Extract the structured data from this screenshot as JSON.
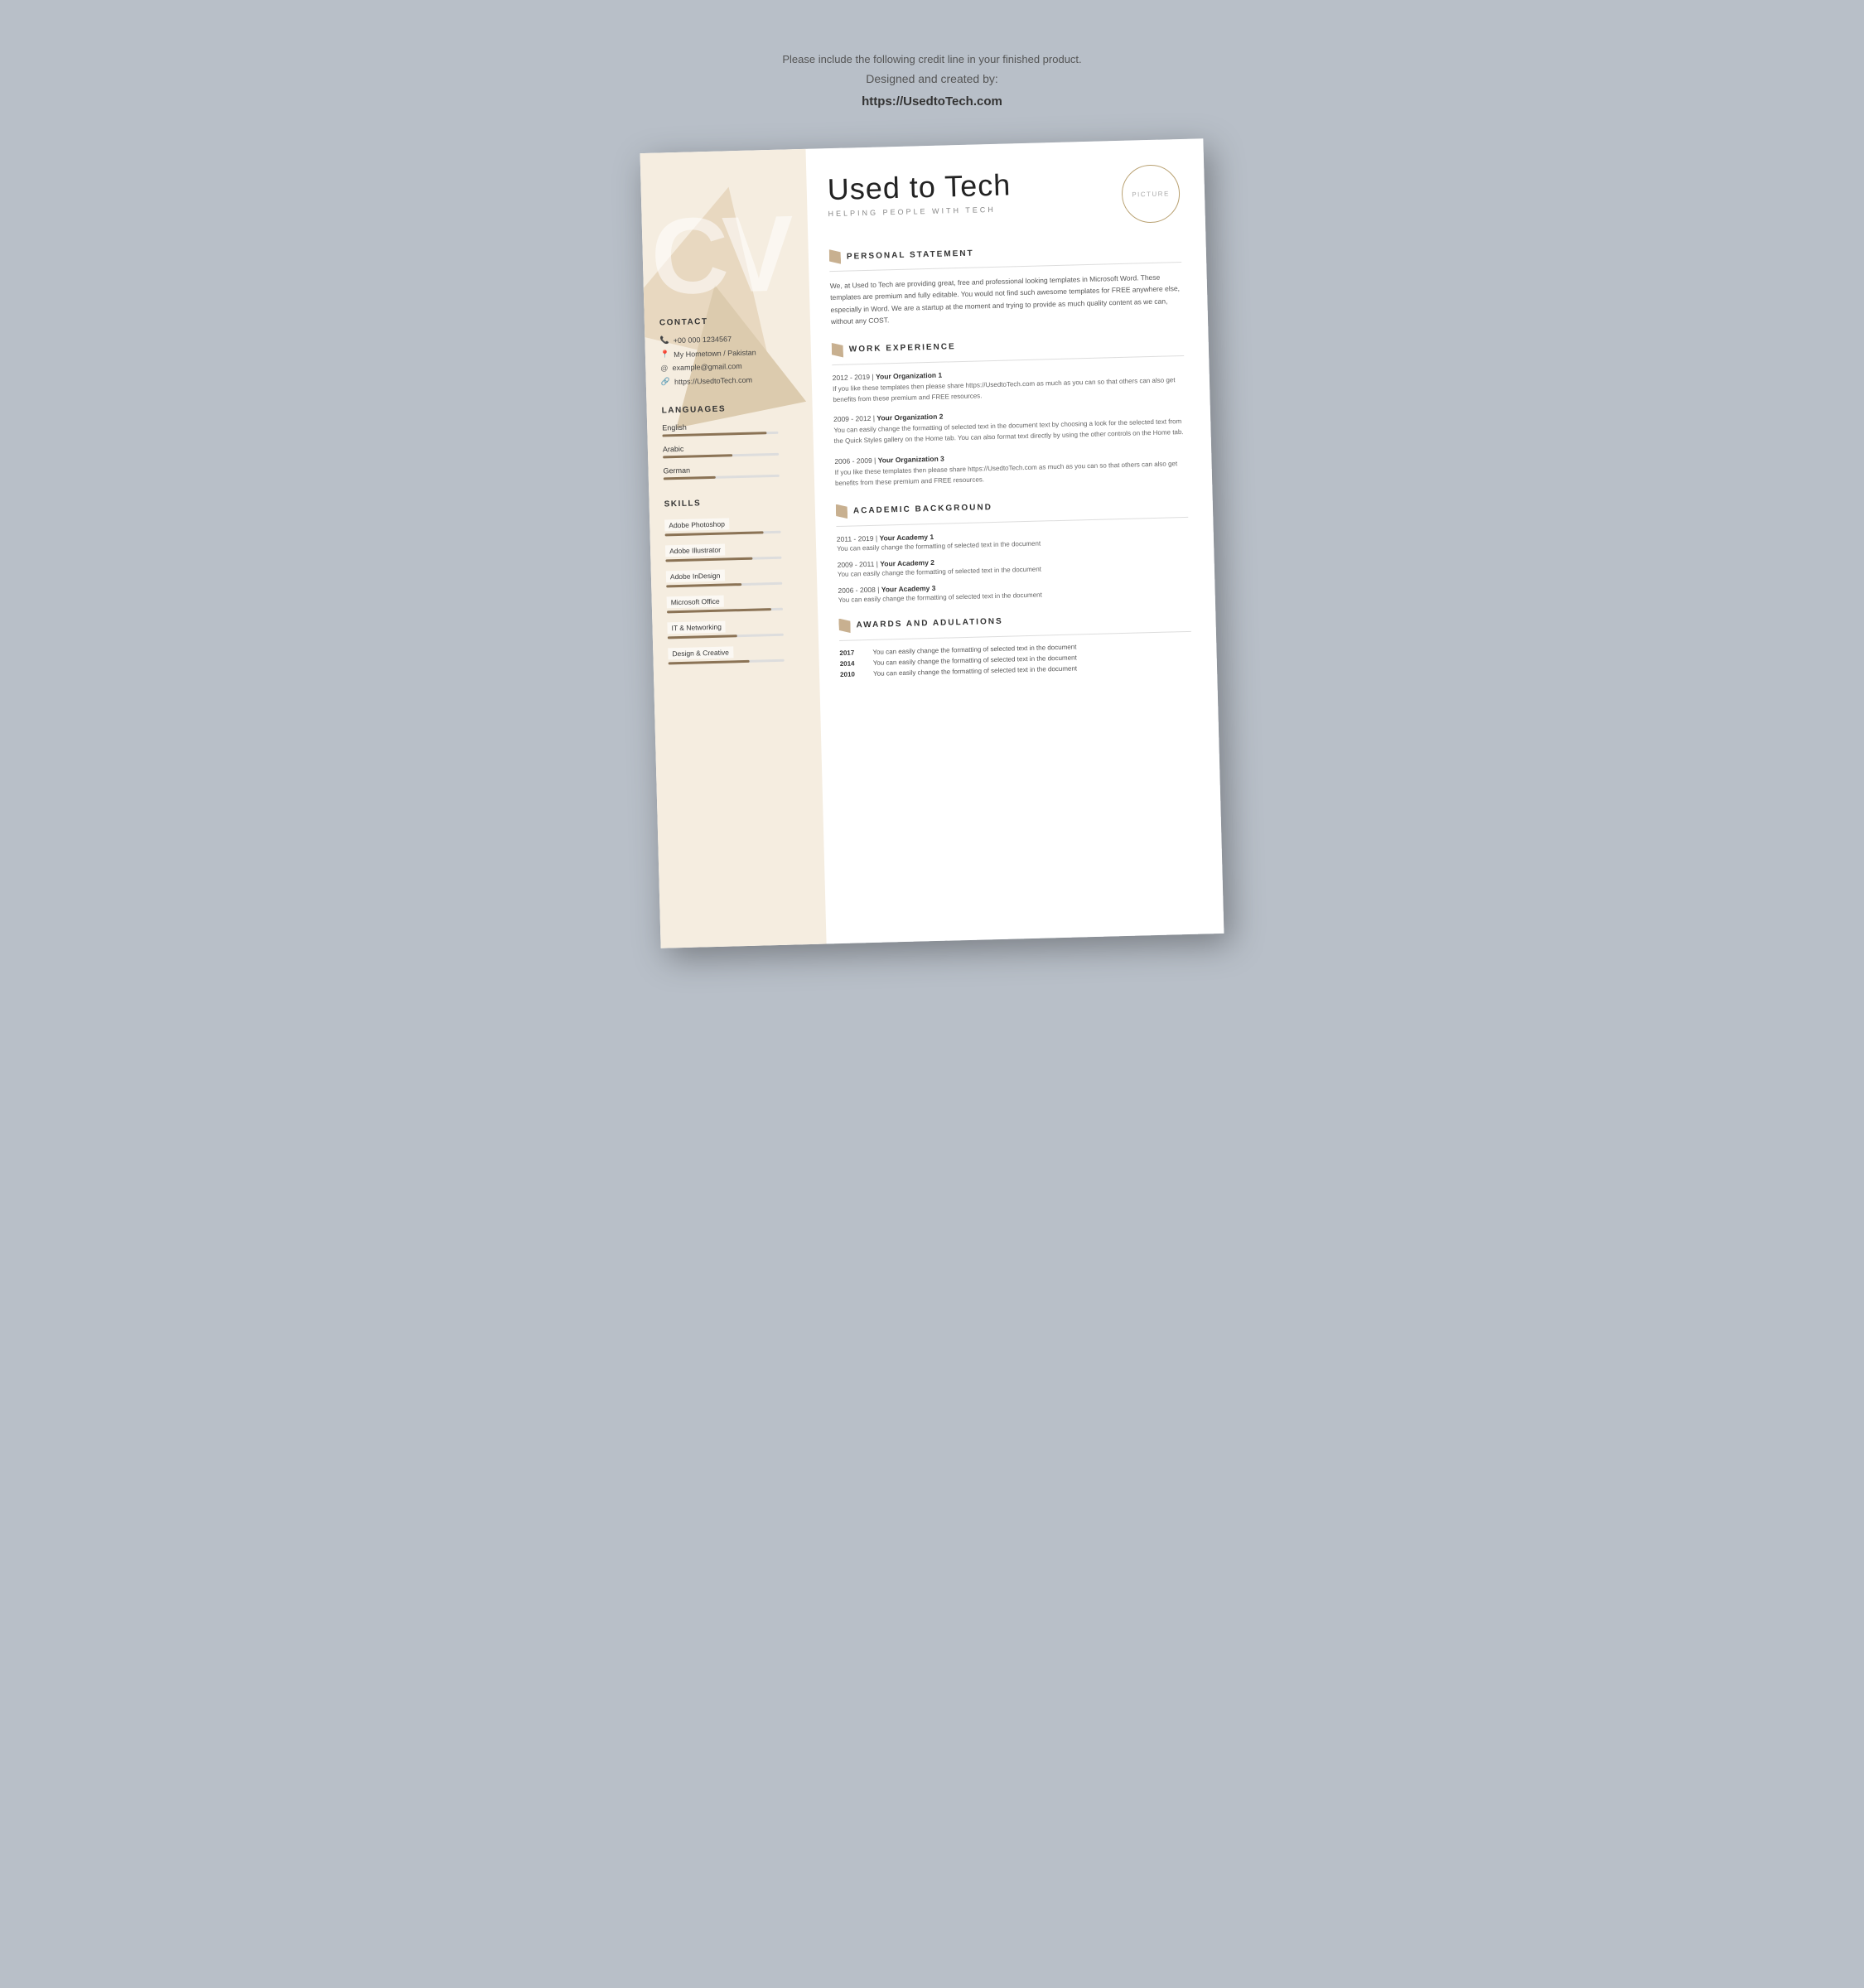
{
  "credit": {
    "line1": "Please include the following credit line in your finished product.",
    "line2": "Designed and created by:",
    "url": "https://UsedtoTech.com"
  },
  "resume": {
    "name": "Used to Tech",
    "tagline": "HELPING PEOPLE WITH TECH",
    "picture_label": "PICTURE",
    "cv_decoration": "CV",
    "sections": {
      "personal_statement": {
        "title": "PERSONAL STATEMENT",
        "text": "We, at Used to Tech are providing great, free and professional looking templates in Microsoft Word. These templates are premium and fully editable. You would not find such awesome templates for FREE anywhere else, especially in Word. We are a startup at the moment and trying to provide as much quality content as we can, without any COST."
      },
      "work_experience": {
        "title": "WORK EXPERIENCE",
        "items": [
          {
            "period": "2012 - 2019",
            "org": "Your Organization 1",
            "desc": "If you like these templates then please share https://UsedtoTech.com as much as you can so that others can also get benefits from these premium and FREE resources."
          },
          {
            "period": "2009 - 2012",
            "org": "Your Organization 2",
            "desc": "You can easily change the formatting of selected text in the document text by choosing a look for the selected text from the Quick Styles gallery on the Home tab. You can also format text directly by using the other controls on the Home tab."
          },
          {
            "period": "2006 - 2009",
            "org": "Your Organization 3",
            "desc": "If you like these templates then please share https://UsedtoTech.com as much as you can so that others can also get benefits from these premium and FREE resources."
          }
        ]
      },
      "academic_background": {
        "title": "ACADEMIC BACKGROUND",
        "items": [
          {
            "period": "2011 - 2019",
            "org": "Your Academy 1",
            "desc": "You can easily change the formatting of selected text in the document"
          },
          {
            "period": "2009 - 2011",
            "org": "Your Academy 2",
            "desc": "You can easily change the formatting of selected text in the document"
          },
          {
            "period": "2006 - 2008",
            "org": "Your Academy 3",
            "desc": "You can easily change the formatting of selected text in the document"
          }
        ]
      },
      "awards": {
        "title": "AWARDS AND ADULATIONS",
        "items": [
          {
            "year": "2017",
            "desc": "You can easily change the formatting of selected text in the document"
          },
          {
            "year": "2014",
            "desc": "You can easily change the formatting of selected text in the document"
          },
          {
            "year": "2010",
            "desc": "You can easily change the formatting of selected text in the document"
          }
        ]
      }
    },
    "sidebar": {
      "contact": {
        "title": "CONTACT",
        "phone": "+00 000 1234567",
        "location": "My Hometown / Pakistan",
        "email": "example@gmail.com",
        "website": "https://UsedtoTech.com"
      },
      "languages": {
        "title": "LANGUAGES",
        "items": [
          {
            "name": "English",
            "level": 0.9
          },
          {
            "name": "Arabic",
            "level": 0.6
          },
          {
            "name": "German",
            "level": 0.45
          }
        ]
      },
      "skills": {
        "title": "SKILLS",
        "items": [
          {
            "name": "Adobe Photoshop",
            "level": 0.85
          },
          {
            "name": "Adobe Illustrator",
            "level": 0.75
          },
          {
            "name": "Adobe InDesign",
            "level": 0.65
          },
          {
            "name": "Microsoft Office",
            "level": 0.9
          },
          {
            "name": "IT & Networking",
            "level": 0.6
          },
          {
            "name": "Design & Creative",
            "level": 0.7
          }
        ]
      }
    }
  }
}
